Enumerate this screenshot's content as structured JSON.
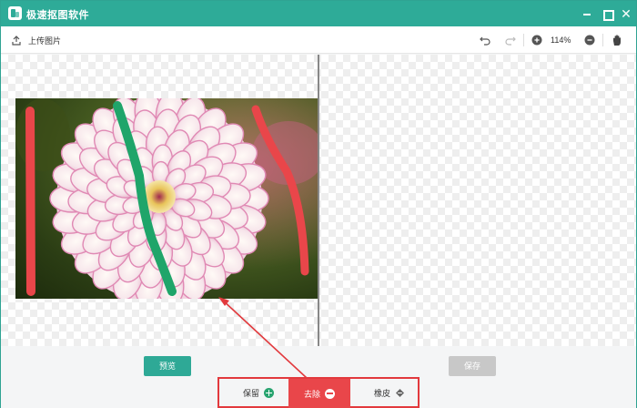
{
  "window": {
    "title": "极速抠图软件",
    "accent_color": "#2eab98"
  },
  "titlebar": {
    "logo_icon": "app-logo-icon",
    "minimize_icon": "minimize-icon",
    "maximize_icon": "maximize-icon",
    "close_icon": "close-icon",
    "close_glyph": "✕"
  },
  "toolbar": {
    "upload_label": "上传图片",
    "upload_icon": "upload-icon",
    "undo_icon": "undo-icon",
    "redo_icon": "redo-icon",
    "zoom_in_icon": "zoom-in-icon",
    "zoom_level": "114%",
    "zoom_out_icon": "zoom-out-icon",
    "hand_icon": "hand-pan-icon"
  },
  "canvas": {
    "left_pane": "original-image-with-strokes",
    "right_pane": "transparent-preview",
    "keep_stroke_color": "#1fa56a",
    "remove_stroke_color": "#e9464a"
  },
  "actions": {
    "preview_label": "预览",
    "save_label": "保存",
    "preview_color": "#2ea996",
    "save_disabled_color": "#c8c8c8"
  },
  "modes": {
    "keep_label": "保留",
    "remove_label": "去除",
    "eraser_label": "橡皮",
    "selected": "去除",
    "highlight_color": "#e2393d"
  }
}
